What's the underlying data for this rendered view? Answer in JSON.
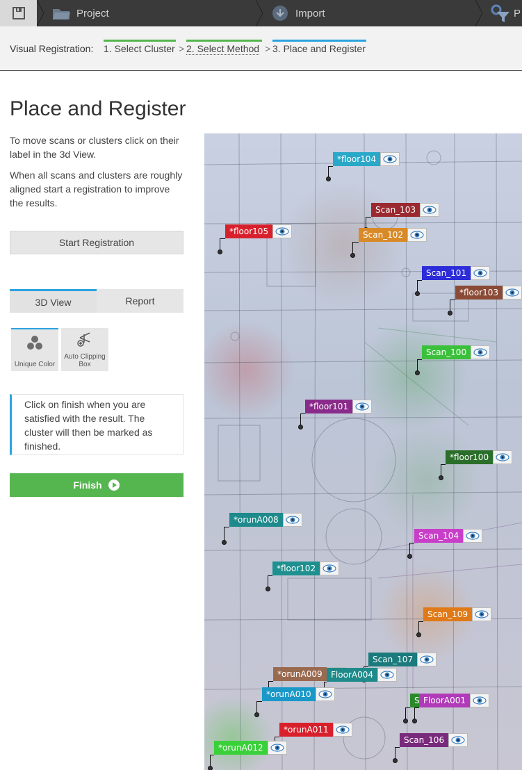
{
  "topbar": {
    "save_icon": "save-icon",
    "steps": [
      {
        "label": "Project",
        "icon": "folder-icon"
      },
      {
        "label": "Import",
        "icon": "import-icon"
      },
      {
        "label": "P",
        "icon": "filter-icon"
      }
    ]
  },
  "breadcrumb": {
    "label": "Visual Registration:",
    "items": [
      "1. Select Cluster",
      "2. Select Method",
      "3. Place and Register"
    ],
    "separator": ">",
    "done_color": "#55b64f",
    "active_color": "#2ba3e0"
  },
  "main": {
    "title": "Place and Register",
    "paragraph1": "To move scans or clusters click on their label in the 3d View.",
    "paragraph2": "When all scans and clusters are roughly aligned start a registration to improve the results.",
    "start_button": "Start Registration",
    "tabs": [
      "3D View",
      "Report"
    ],
    "tools": [
      {
        "label": "Unique Color",
        "icon": "unique-color-icon"
      },
      {
        "label": "Auto Clipping Box",
        "icon": "auto-clipping-box-icon"
      }
    ],
    "notice": "Click on finish when you are satisfied with the result. The cluster will then be marked as finished.",
    "finish_button": "Finish",
    "finish_icon": "play-icon"
  },
  "view3d": {
    "labels": [
      {
        "text": "*floor104",
        "color": "#2aa8c8"
      },
      {
        "text": "Scan_103",
        "color": "#9a2a30"
      },
      {
        "text": "*floor105",
        "color": "#d8202c"
      },
      {
        "text": "Scan_102",
        "color": "#d98a28"
      },
      {
        "text": "Scan_101",
        "color": "#2c2cd8"
      },
      {
        "text": "*floor103",
        "color": "#8a4a36"
      },
      {
        "text": "Scan_100",
        "color": "#3ac03a"
      },
      {
        "text": "*floor101",
        "color": "#8a2a8a"
      },
      {
        "text": "*floor100",
        "color": "#2a6e2a"
      },
      {
        "text": "*orunA008",
        "color": "#1e8a8c"
      },
      {
        "text": "Scan_104",
        "color": "#c83ec8"
      },
      {
        "text": "*floor102",
        "color": "#1e9090"
      },
      {
        "text": "Scan_109",
        "color": "#e07a18"
      },
      {
        "text": "Scan_107",
        "color": "#1a7a7c"
      },
      {
        "text": "*orunA009",
        "color": "#9a6a50"
      },
      {
        "text": "FloorA004",
        "color": "#1e8a8a"
      },
      {
        "text": "*orunA010",
        "color": "#1a98c8"
      },
      {
        "text": "Sc",
        "color": "#2a8a2a"
      },
      {
        "text": "FloorA001",
        "color": "#b03ab8"
      },
      {
        "text": "*orunA011",
        "color": "#d8202c"
      },
      {
        "text": "Scan_106",
        "color": "#7a2a7c"
      },
      {
        "text": "*orunA012",
        "color": "#3ad03a"
      }
    ]
  }
}
